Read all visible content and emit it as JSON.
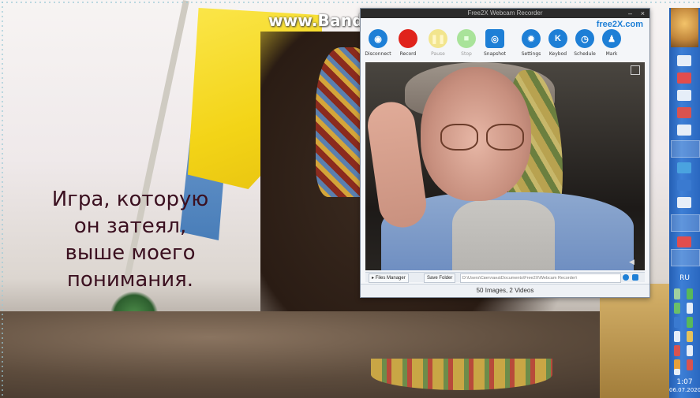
{
  "watermark": "www.Bandicam.com",
  "subtitle": {
    "lines": [
      "Игра, которую",
      "он затеял,",
      "выше моего",
      "понимания."
    ]
  },
  "app": {
    "title": "Free2X Webcam Recorder",
    "brand": "free2X.com",
    "toolbar": [
      {
        "id": "disconnect",
        "label": "Disconnect",
        "icon": "webcam-icon",
        "color": "#1e7fd6",
        "enabled": true
      },
      {
        "id": "record",
        "label": "Record",
        "icon": "record-icon",
        "color": "#e0231b",
        "enabled": true
      },
      {
        "id": "pause",
        "label": "Pause",
        "icon": "pause-icon",
        "color": "#f2e58d",
        "enabled": false
      },
      {
        "id": "stop",
        "label": "Stop",
        "icon": "stop-icon",
        "color": "#a9e39a",
        "enabled": false
      },
      {
        "id": "snapshot",
        "label": "Snapshot",
        "icon": "camera-icon",
        "color": "#1e7fd6",
        "enabled": true
      },
      {
        "id": "settings",
        "label": "Settings",
        "icon": "gear-icon",
        "color": "#1e7fd6",
        "enabled": true
      },
      {
        "id": "keybod",
        "label": "Keybod",
        "icon": "k-icon",
        "color": "#1e7fd6",
        "enabled": true
      },
      {
        "id": "schedule",
        "label": "Schedule",
        "icon": "clock-icon",
        "color": "#1e7fd6",
        "enabled": true
      },
      {
        "id": "mark",
        "label": "Mark",
        "icon": "person-icon",
        "color": "#1e7fd6",
        "enabled": true
      }
    ],
    "bottombar": {
      "files_manager": "Files Manager",
      "save_folder": "Save Folder",
      "path": "D:\\Users\\Светлана\\Documents\\Free2X\\Webcam Recorder\\"
    },
    "status": "50 Images, 2 Videos"
  },
  "taskbar": {
    "lang": "RU",
    "time": "1:07",
    "date": "06.07.2020"
  },
  "colors": {
    "accent": "#1e7fd6",
    "taskbar": "#2a67c0",
    "subtitle": "#3b1020"
  }
}
